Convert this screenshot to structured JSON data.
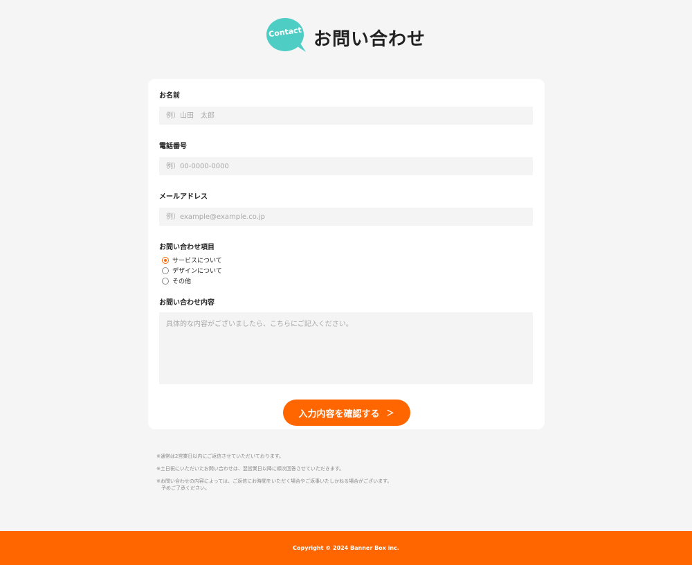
{
  "header": {
    "badge": "Contact",
    "title": "お問い合わせ"
  },
  "form": {
    "name": {
      "label": "お名前",
      "placeholder": "例）山田　太郎"
    },
    "phone": {
      "label": "電話番号",
      "placeholder": "例）00-0000-0000"
    },
    "email": {
      "label": "メールアドレス",
      "placeholder": "例）example@example.co.jp"
    },
    "inquiry_type": {
      "label": "お問い合わせ項目",
      "options": [
        {
          "label": "サービスについて",
          "checked": true
        },
        {
          "label": "デザインについて",
          "checked": false
        },
        {
          "label": "その他",
          "checked": false
        }
      ]
    },
    "message": {
      "label": "お問い合わせ内容",
      "placeholder": "具体的な内容がございましたら、こちらにご記入ください。"
    },
    "submit_label": "入力内容を確認する",
    "submit_chevron": "＞"
  },
  "notes": [
    "※通常は2営業日以内にご返信させていただいております。",
    "※土日祝にいただいたお問い合わせは、翌営業日以降に順次回答させていただきます。",
    "※お問い合わせの内容によっては、ご返信にお時間をいただく場合やご返事いたしかねる場合がございます。\n　予めご了承ください。"
  ],
  "footer": {
    "copyright": "Copyright © 2024 Banner Box inc."
  },
  "colors": {
    "accent": "#ff6600",
    "badge": "#4ecdc4",
    "background": "#f5f5f5"
  },
  "icons": {
    "badge": "speech-bubble-icon",
    "chevron": "chevron-right-icon"
  }
}
